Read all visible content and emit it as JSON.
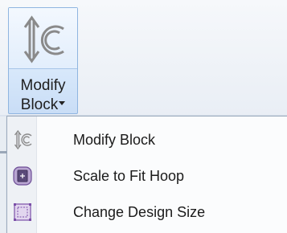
{
  "ribbon": {
    "button": {
      "label_line1": "Modify",
      "label_line2": "Block",
      "icon": "modify-block-icon",
      "dropdown_icon": "caret-down-icon"
    }
  },
  "menu": {
    "items": [
      {
        "label": "Modify Block",
        "icon": "modify-block-icon"
      },
      {
        "label": "Scale to Fit Hoop",
        "icon": "scale-to-fit-hoop-icon"
      },
      {
        "label": "Change Design Size",
        "icon": "change-design-size-icon"
      }
    ]
  },
  "colors": {
    "highlight_border": "#8fb5e0",
    "highlight_fill": "#d9e9fb",
    "menu_background": "#fbfcfd",
    "icon_purple": "#7b4fa8"
  }
}
